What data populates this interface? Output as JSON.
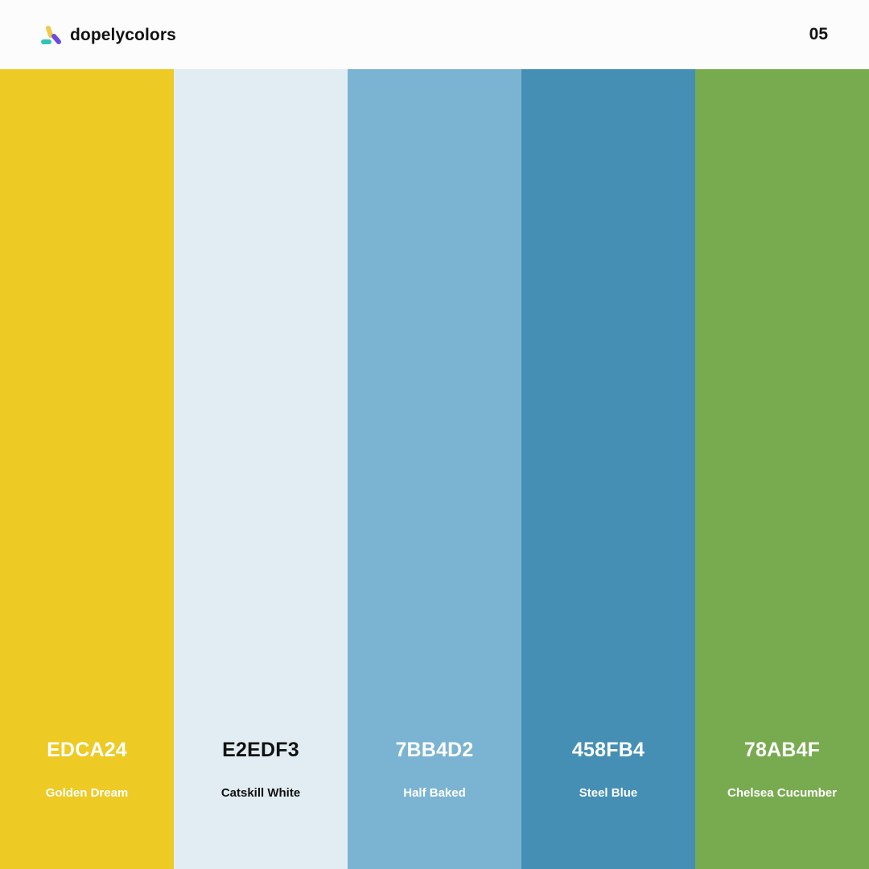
{
  "header": {
    "brand_name": "dopelycolors",
    "logo_icon": "dopelycolors-logo-icon",
    "page_number": "05"
  },
  "swatches": [
    {
      "hex": "EDCA24",
      "name": "Golden Dream",
      "color": "#EDCA24",
      "text_color": "#FFFFFF"
    },
    {
      "hex": "E2EDF3",
      "name": "Catskill White",
      "color": "#E2EDF3",
      "text_color": "#111111"
    },
    {
      "hex": "7BB4D2",
      "name": "Half Baked",
      "color": "#7BB4D2",
      "text_color": "#FFFFFF"
    },
    {
      "hex": "458FB4",
      "name": "Steel Blue",
      "color": "#458FB4",
      "text_color": "#FFFFFF"
    },
    {
      "hex": "78AB4F",
      "name": "Chelsea Cucumber",
      "color": "#78AB4F",
      "text_color": "#FFFFFF"
    }
  ]
}
